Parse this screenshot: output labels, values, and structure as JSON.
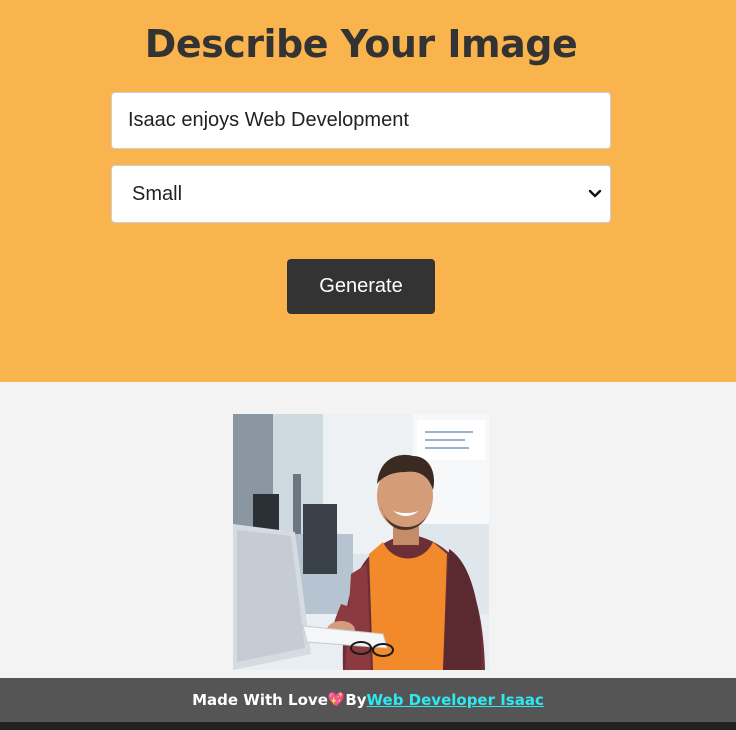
{
  "header": {
    "title": "Describe Your Image"
  },
  "form": {
    "prompt_value": "Isaac enjoys Web Development",
    "size_selected": "Small",
    "generate_label": "Generate"
  },
  "footer": {
    "made_with": "Made With Love",
    "heart": "💖",
    "by": "By",
    "author_link": "Web Developer Isaac"
  },
  "colors": {
    "header_bg": "#f9b44e",
    "page_bg": "#f3f3f3",
    "button_bg": "#333333",
    "footer_bg": "#555555",
    "link": "#2ee8f2"
  }
}
